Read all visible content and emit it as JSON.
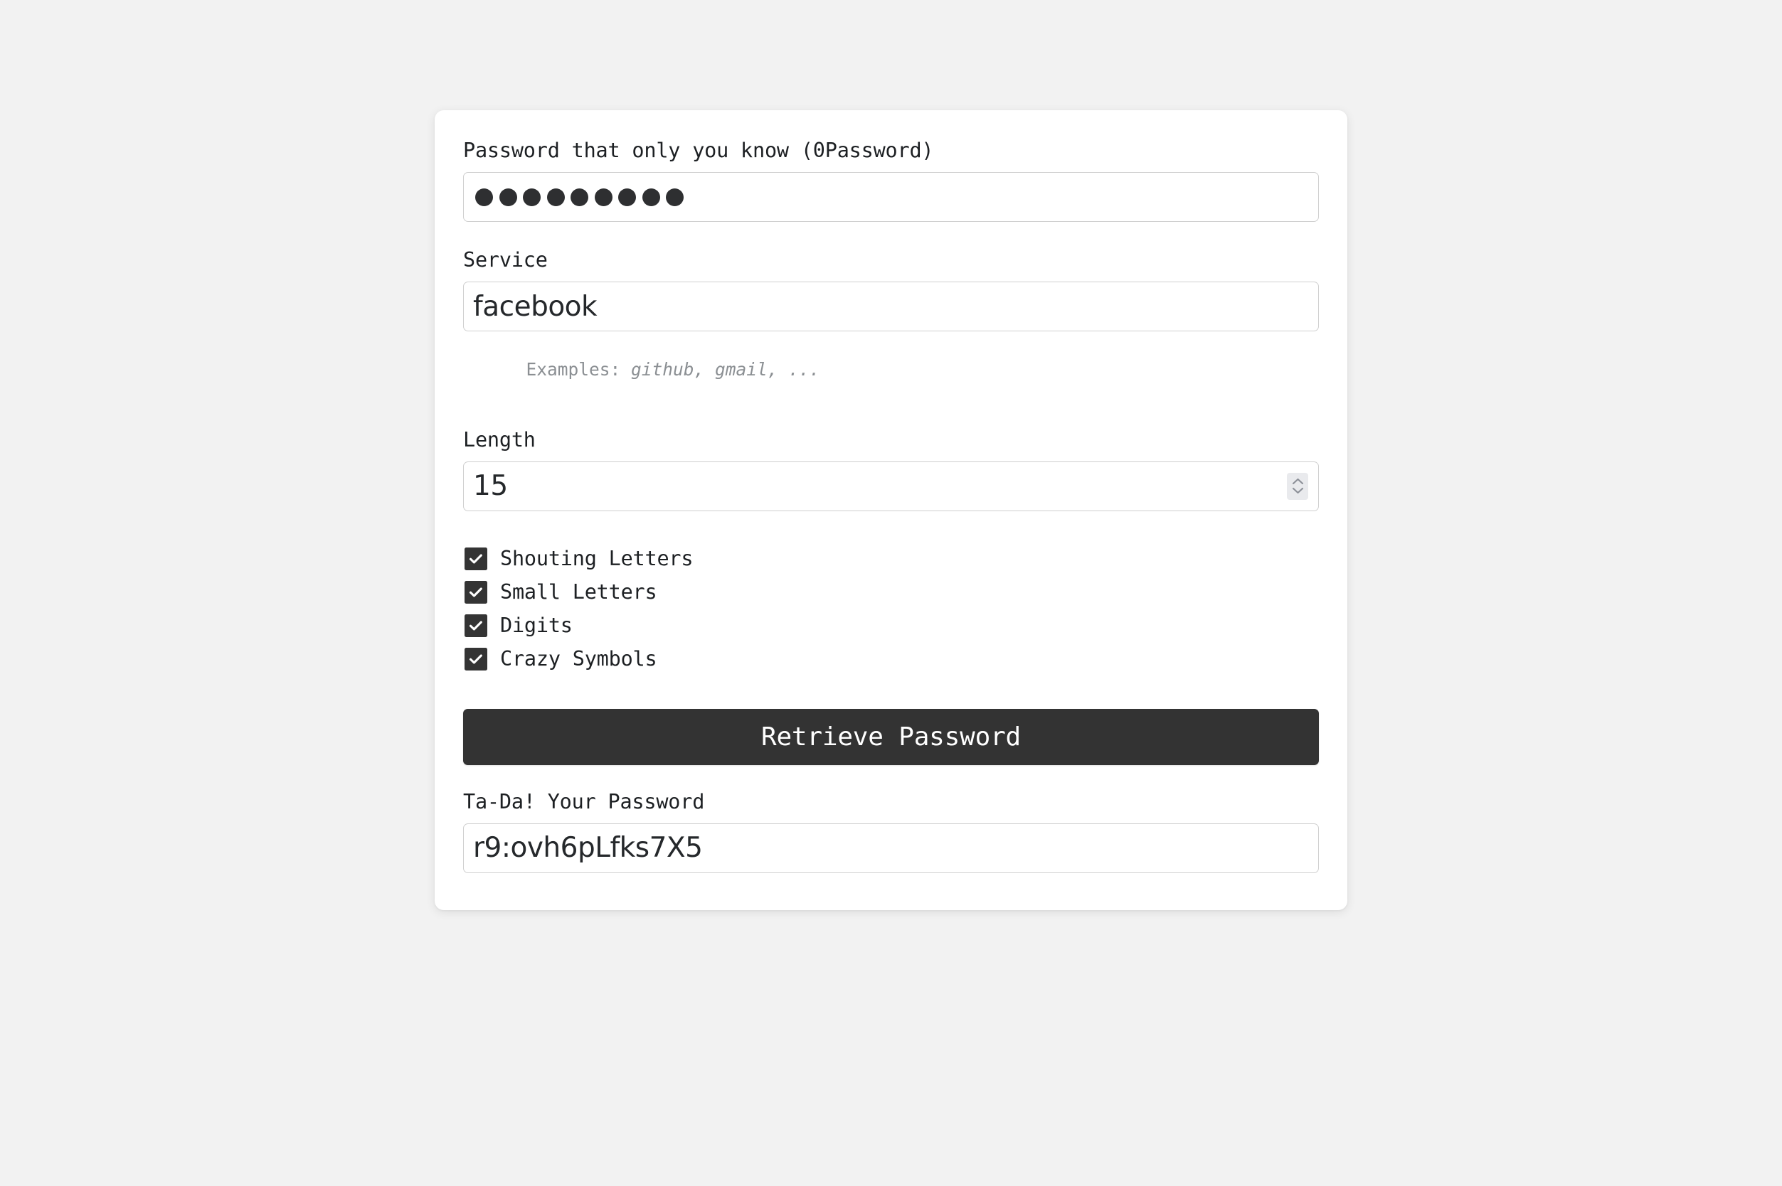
{
  "card": {
    "master_password": {
      "label": "Password that only you know (0Password)",
      "masked_char_count": 9,
      "value_masked": "•••••••••"
    },
    "service": {
      "label": "Service",
      "value": "facebook",
      "hint_prefix": "Examples: ",
      "hint_examples": "github, gmail, ..."
    },
    "length": {
      "label": "Length",
      "value": "15",
      "stepper_up_icon": "chevron-up-icon",
      "stepper_down_icon": "chevron-down-icon"
    },
    "options": [
      {
        "label": "Shouting Letters",
        "checked": true
      },
      {
        "label": "Small Letters",
        "checked": true
      },
      {
        "label": "Digits",
        "checked": true
      },
      {
        "label": "Crazy Symbols",
        "checked": true
      }
    ],
    "submit": {
      "label": "Retrieve Password"
    },
    "result": {
      "label": "Ta-Da! Your Password",
      "value": "r9:ovh6pLfks7X5"
    }
  },
  "colors": {
    "page_background": "#f2f2f2",
    "card_background": "#ffffff",
    "accent_dark": "#333333",
    "text_primary": "#1d2023",
    "text_muted": "#8b8f93",
    "input_border": "#cfcfcf",
    "spinner_background": "#e9eaed"
  }
}
